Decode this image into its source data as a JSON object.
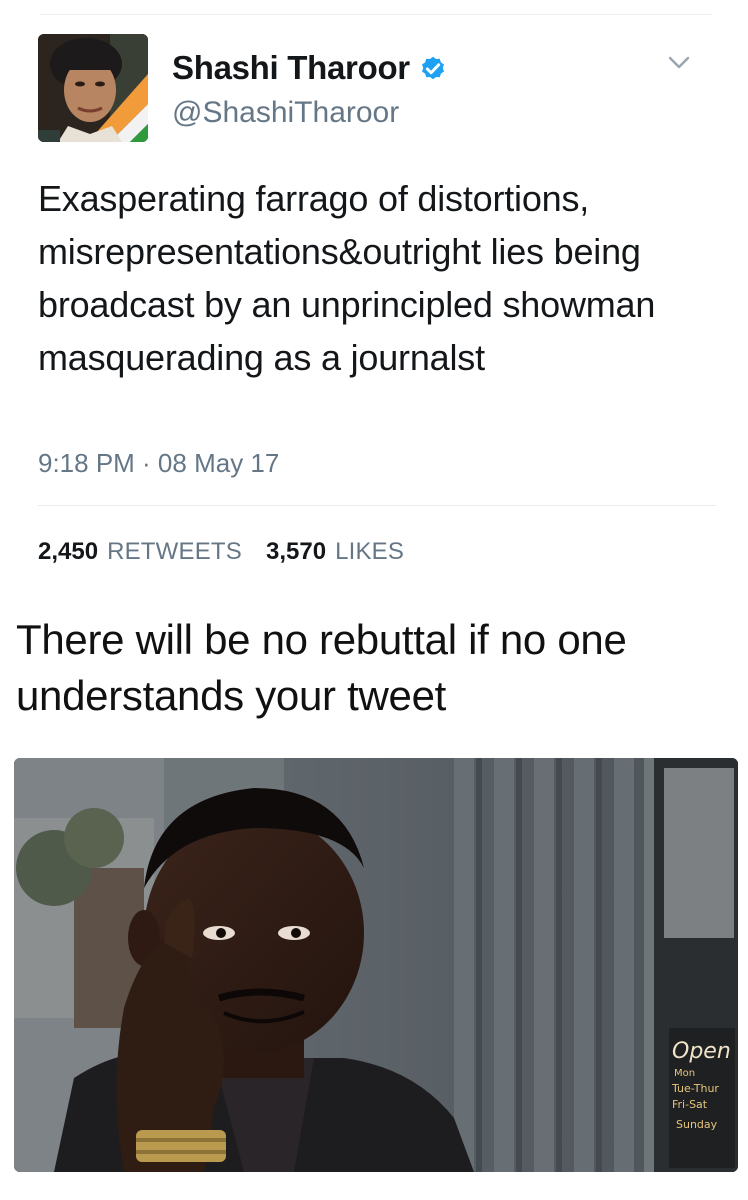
{
  "tweet": {
    "display_name": "Shashi Tharoor",
    "handle": "@ShashiTharoor",
    "verified": true,
    "verified_icon": "verified-badge-icon",
    "menu_icon": "chevron-down-icon",
    "text": "Exasperating farrago of distortions, misrepresentations&outright lies being broadcast by an unprincipled showman masquerading as a journalst",
    "timestamp": "9:18 PM · 08 May 17",
    "retweets_count": "2,450",
    "retweets_label": "RETWEETS",
    "likes_count": "3,570",
    "likes_label": "LIKES"
  },
  "caption": "There will be no rebuttal if no one understands your tweet",
  "meme_image": {
    "sign_lines": [
      "Open",
      "Mon",
      "Tue-Thur",
      "Fri-Sat",
      "Sunday"
    ]
  },
  "colors": {
    "verified_blue": "#1da1f2",
    "secondary_text": "#657786",
    "primary_text": "#14171a"
  }
}
